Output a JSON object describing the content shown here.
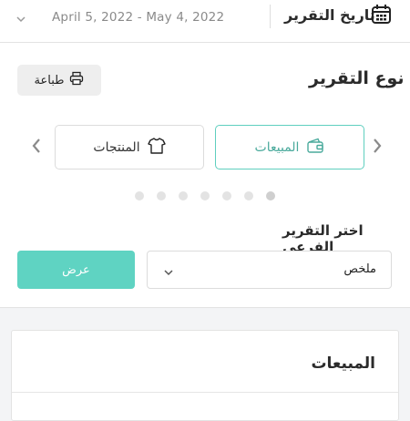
{
  "header": {
    "title": "تاريخ التقرير",
    "date_range": "April 5, 2022 - May 4, 2022"
  },
  "report_type": {
    "title": "نوع التقرير",
    "print_label": "طباعة",
    "tabs": [
      {
        "label": "المبيعات",
        "icon": "wallet-icon",
        "active": true
      },
      {
        "label": "المنتجات",
        "icon": "shirt-icon",
        "active": false
      }
    ],
    "pagination_total": 7,
    "pagination_active": 1
  },
  "sub_report": {
    "title": "اختر التقرير الفرعي",
    "selected": "ملخص",
    "submit_label": "عرض"
  },
  "sales_card": {
    "title": "المبيعات"
  },
  "colors": {
    "accent": "#5fd3c2",
    "accent_text": "#4aaa9c",
    "background": "#f3f4f6"
  }
}
